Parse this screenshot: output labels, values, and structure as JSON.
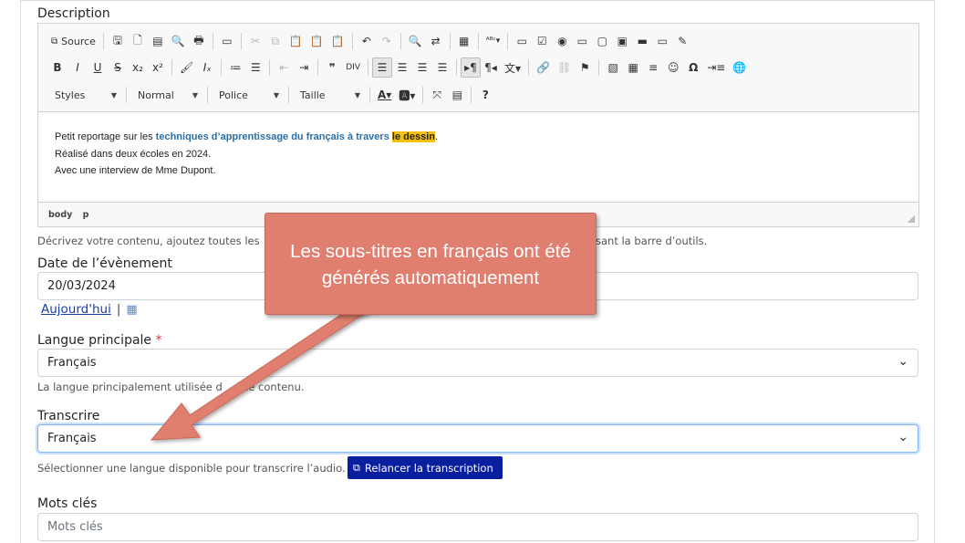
{
  "description_label": "Description",
  "editor": {
    "toolbar": {
      "source_label": "Source",
      "styles_label": "Styles",
      "format_label": "Normal",
      "font_label": "Police",
      "size_label": "Taille"
    },
    "content": {
      "line1_prefix": "Petit reportage sur les ",
      "line1_keyword": "techniques d’apprentissage du français à travers",
      "line1_space": " ",
      "line1_highlight": "le dessin",
      "line1_suffix": ".",
      "line2": "Réalisé dans deux écoles en 2024.",
      "line3": "Avec une interview de Mme Dupont."
    },
    "path": [
      "body",
      "p"
    ]
  },
  "description_help": "Décrivez votre contenu, ajoutez toutes les",
  "description_help_end": "sant la barre d’outils.",
  "event_date": {
    "label": "Date de l’évènement",
    "value": "20/03/2024",
    "today_link": "Aujourd'hui",
    "separator": "|",
    "calendar_icon": "calendar-icon"
  },
  "main_language": {
    "label": "Langue principale",
    "required_mark": "*",
    "value": "Français",
    "help": "La langue principalement utilisée d",
    "help_end": "ce contenu."
  },
  "transcribe": {
    "label": "Transcrire",
    "value": "Français",
    "help": "Sélectionner une langue disponible pour transcrire l’audio.",
    "button_label": "Relancer la transcription"
  },
  "keywords": {
    "label": "Mots clés",
    "placeholder": "Mots clés"
  },
  "callout": {
    "line1": "Les sous-titres en français ont été",
    "line2": "générés automatiquement"
  },
  "colors": {
    "callout_bg": "#e07f6f",
    "button_bg": "#0a1f9e",
    "highlight": "#f6c10e",
    "keyword_text": "#2a6fa8"
  }
}
